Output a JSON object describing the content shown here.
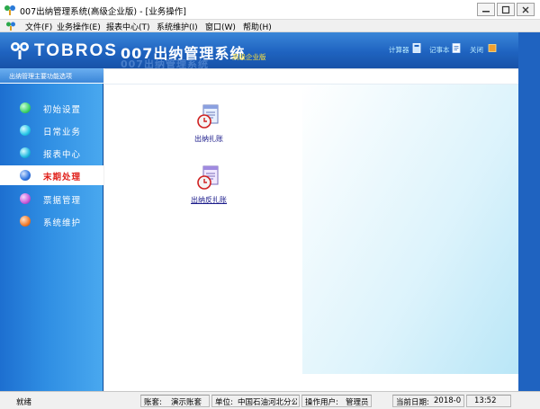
{
  "window": {
    "title": "007出纳管理系统(高级企业版) - [业务操作]"
  },
  "menu": {
    "items": [
      "文件(F)",
      "业务操作(E)",
      "报表中心(T)",
      "系统维护(I)",
      "窗口(W)",
      "帮助(H)"
    ]
  },
  "banner": {
    "brand": "TOBROS",
    "system_title": "007出纳管理系统",
    "edition": "高级企业版",
    "tools": [
      "计算器",
      "记事本",
      "关闭"
    ]
  },
  "sidebar": {
    "header": "出纳管理主要功能选项",
    "items": [
      {
        "label": "初始设置",
        "color": "#3fd26a"
      },
      {
        "label": "日常业务",
        "color": "#26c6e8"
      },
      {
        "label": "报表中心",
        "color": "#20b8e0"
      },
      {
        "label": "末期处理",
        "color": "#2f74e0"
      },
      {
        "label": "票据管理",
        "color": "#c85ad8"
      },
      {
        "label": "系统维护",
        "color": "#f07a2a"
      }
    ],
    "active": "末期处理"
  },
  "workspace": {
    "functions": [
      {
        "label": "出纳扎账",
        "icon": "ledger-clock-icon"
      },
      {
        "label": "出纳反扎账",
        "icon": "ledger-clock-icon"
      }
    ]
  },
  "status": {
    "ready": "就绪",
    "account_label": "账套:",
    "account_value": "演示账套",
    "unit_label": "单位:",
    "unit_value": "中国石油河北分公",
    "user_label": "操作用户:",
    "user_value": "管理员",
    "date_label": "当前日期:",
    "date_value": "2018-0",
    "time_value": "13:52"
  },
  "colors": {
    "banner_blue": "#1f63c0",
    "edition_yellow": "#ffe23a",
    "active_red": "#e0201a"
  }
}
